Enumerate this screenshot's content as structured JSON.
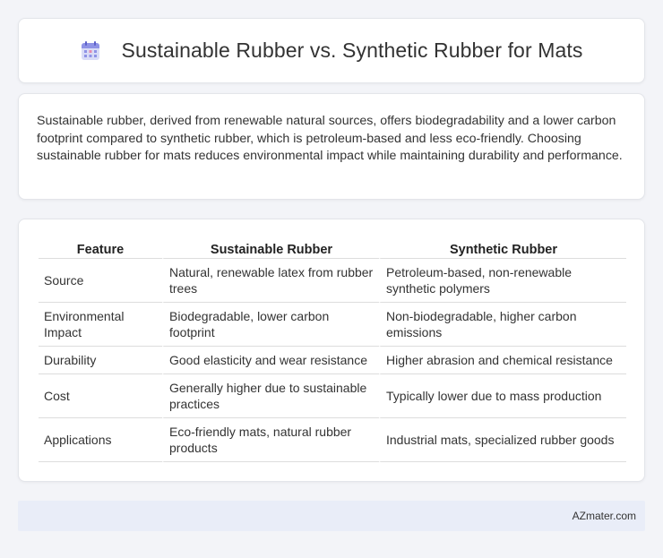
{
  "header": {
    "title": "Sustainable Rubber vs. Synthetic Rubber for Mats",
    "icon": "calendar-icon"
  },
  "summary": {
    "text": "Sustainable rubber, derived from renewable natural sources, offers biodegradability and a lower carbon footprint compared to synthetic rubber, which is petroleum-based and less eco-friendly. Choosing sustainable rubber for mats reduces environmental impact while maintaining durability and performance."
  },
  "table": {
    "headers": [
      "Feature",
      "Sustainable Rubber",
      "Synthetic Rubber"
    ],
    "rows": [
      [
        "Source",
        "Natural, renewable latex from rubber trees",
        "Petroleum-based, non-renewable synthetic polymers"
      ],
      [
        "Environmental Impact",
        "Biodegradable, lower carbon footprint",
        "Non-biodegradable, higher carbon emissions"
      ],
      [
        "Durability",
        "Good elasticity and wear resistance",
        "Higher abrasion and chemical resistance"
      ],
      [
        "Cost",
        "Generally higher due to sustainable practices",
        "Typically lower due to mass production"
      ],
      [
        "Applications",
        "Eco-friendly mats, natural rubber products",
        "Industrial mats, specialized rubber goods"
      ]
    ]
  },
  "footer": {
    "text": "AZmater.com"
  },
  "colors": {
    "background": "#f3f4f8",
    "card": "#ffffff",
    "footer": "#e9edf8",
    "icon_accent": "#7b7fdc"
  }
}
